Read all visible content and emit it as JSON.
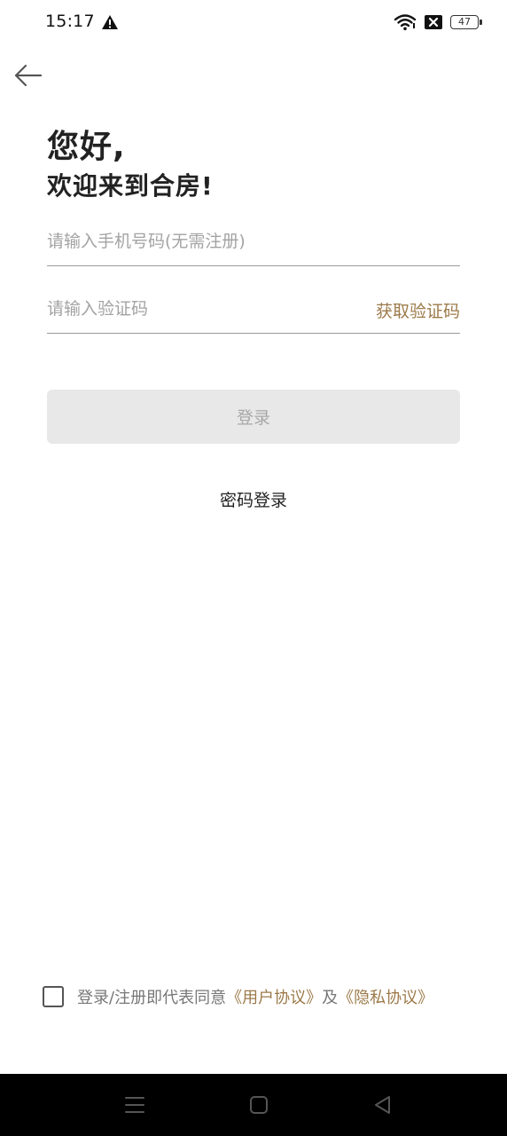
{
  "status_bar": {
    "time": "15:17",
    "battery": "47",
    "icons": [
      "warning-icon",
      "wifi-icon",
      "no-sim-icon",
      "battery-icon"
    ]
  },
  "header": {
    "back_icon": "arrow-left-icon"
  },
  "greeting": {
    "title": "您好,",
    "subtitle": "欢迎来到合房!"
  },
  "form": {
    "phone_placeholder": "请输入手机号码(无需注册)",
    "phone_value": "",
    "code_placeholder": "请输入验证码",
    "code_value": "",
    "get_code_label": "获取验证码",
    "login_label": "登录",
    "password_login_label": "密码登录"
  },
  "agreement": {
    "checked": false,
    "prefix": "登录/注册即代表同意",
    "user_agreement": "《用户协议》",
    "conjunction": "及",
    "privacy_agreement": "《隐私协议》"
  },
  "colors": {
    "accent": "#9c7a4a",
    "button_disabled_bg": "#e8e8e8",
    "button_disabled_text": "#a8a8a8"
  },
  "nav_bar": {
    "icons": [
      "menu-icon",
      "home-square-icon",
      "back-triangle-icon"
    ]
  }
}
